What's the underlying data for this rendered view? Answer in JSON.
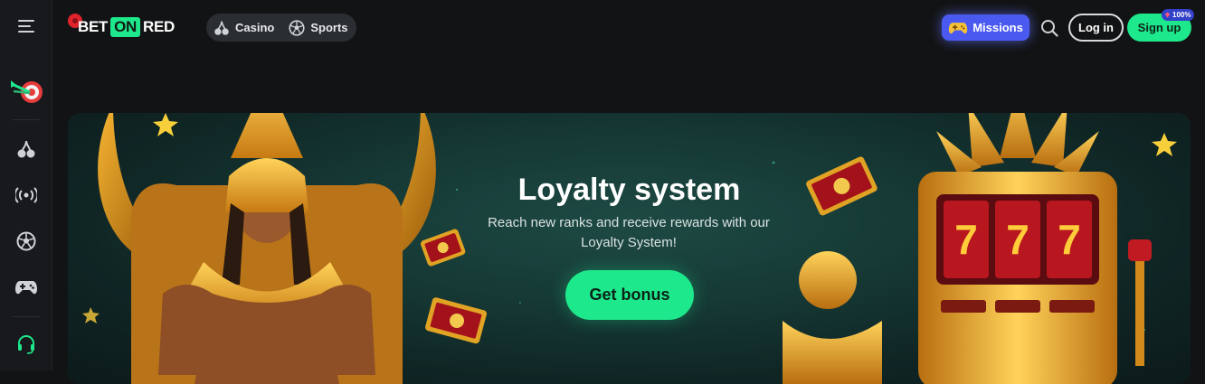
{
  "header": {
    "logo_bet": "BET",
    "logo_on": "ON",
    "logo_red": "RED",
    "nav": [
      {
        "label": "Casino",
        "icon": "cherry-icon"
      },
      {
        "label": "Sports",
        "icon": "soccer-ball-icon"
      }
    ],
    "missions_label": "Missions",
    "login_label": "Log in",
    "signup_label": "Sign up",
    "signup_badge": "100%"
  },
  "sidebar": {
    "items": [
      {
        "icon": "menu-icon"
      },
      {
        "icon": "dart-target-icon"
      },
      {
        "icon": "cherry-icon"
      },
      {
        "icon": "live-broadcast-icon"
      },
      {
        "icon": "soccer-ball-icon"
      },
      {
        "icon": "gamepad-icon"
      },
      {
        "icon": "headset-support-icon"
      }
    ]
  },
  "banner": {
    "title": "Loyalty system",
    "subtitle": "Reach new ranks and receive rewards with our Loyalty System!",
    "button_label": "Get bonus"
  },
  "colors": {
    "accent_green": "#1ee88c",
    "missions_blue": "#4a5af0",
    "background": "#121314",
    "banner_teal": "#1e4a44",
    "gold": "#e0a324"
  }
}
